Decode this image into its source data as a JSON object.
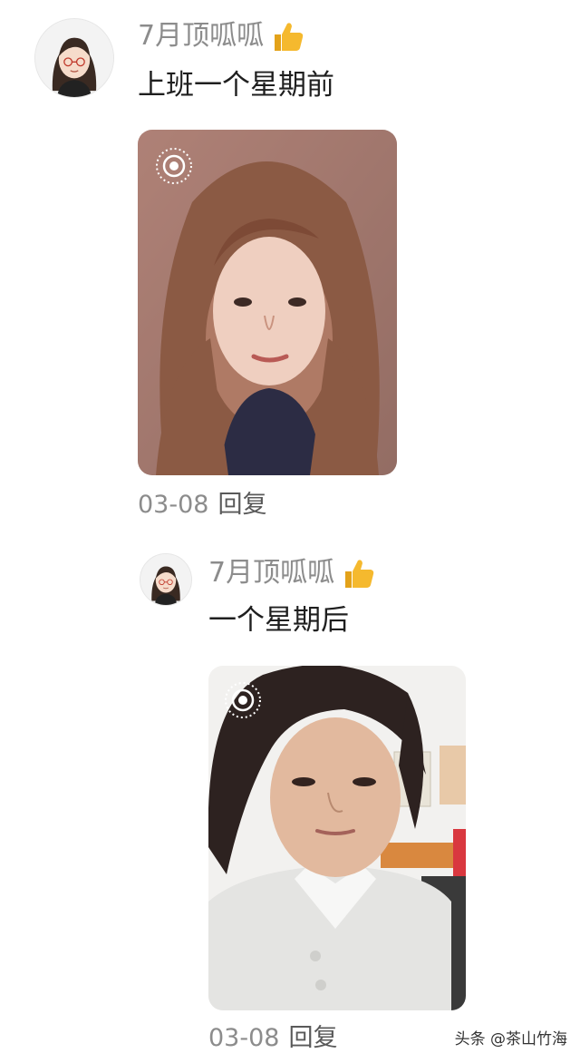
{
  "comments": [
    {
      "username": "7月顶呱呱",
      "text": "上班一个星期前",
      "date": "03-08",
      "reply_label": "回复",
      "badge_icon": "thumbs-up-icon",
      "photo_icon": "live-photo-icon"
    },
    {
      "username": "7月顶呱呱",
      "text": "一个星期后",
      "date": "03-08",
      "reply_label": "回复",
      "badge_icon": "thumbs-up-icon",
      "photo_icon": "live-photo-icon"
    }
  ],
  "watermark": "头条 @茶山竹海",
  "colors": {
    "username": "#8c8c8c",
    "text": "#1f1f1f",
    "meta": "#8c8c8c",
    "thumb": "#f5b92e"
  }
}
